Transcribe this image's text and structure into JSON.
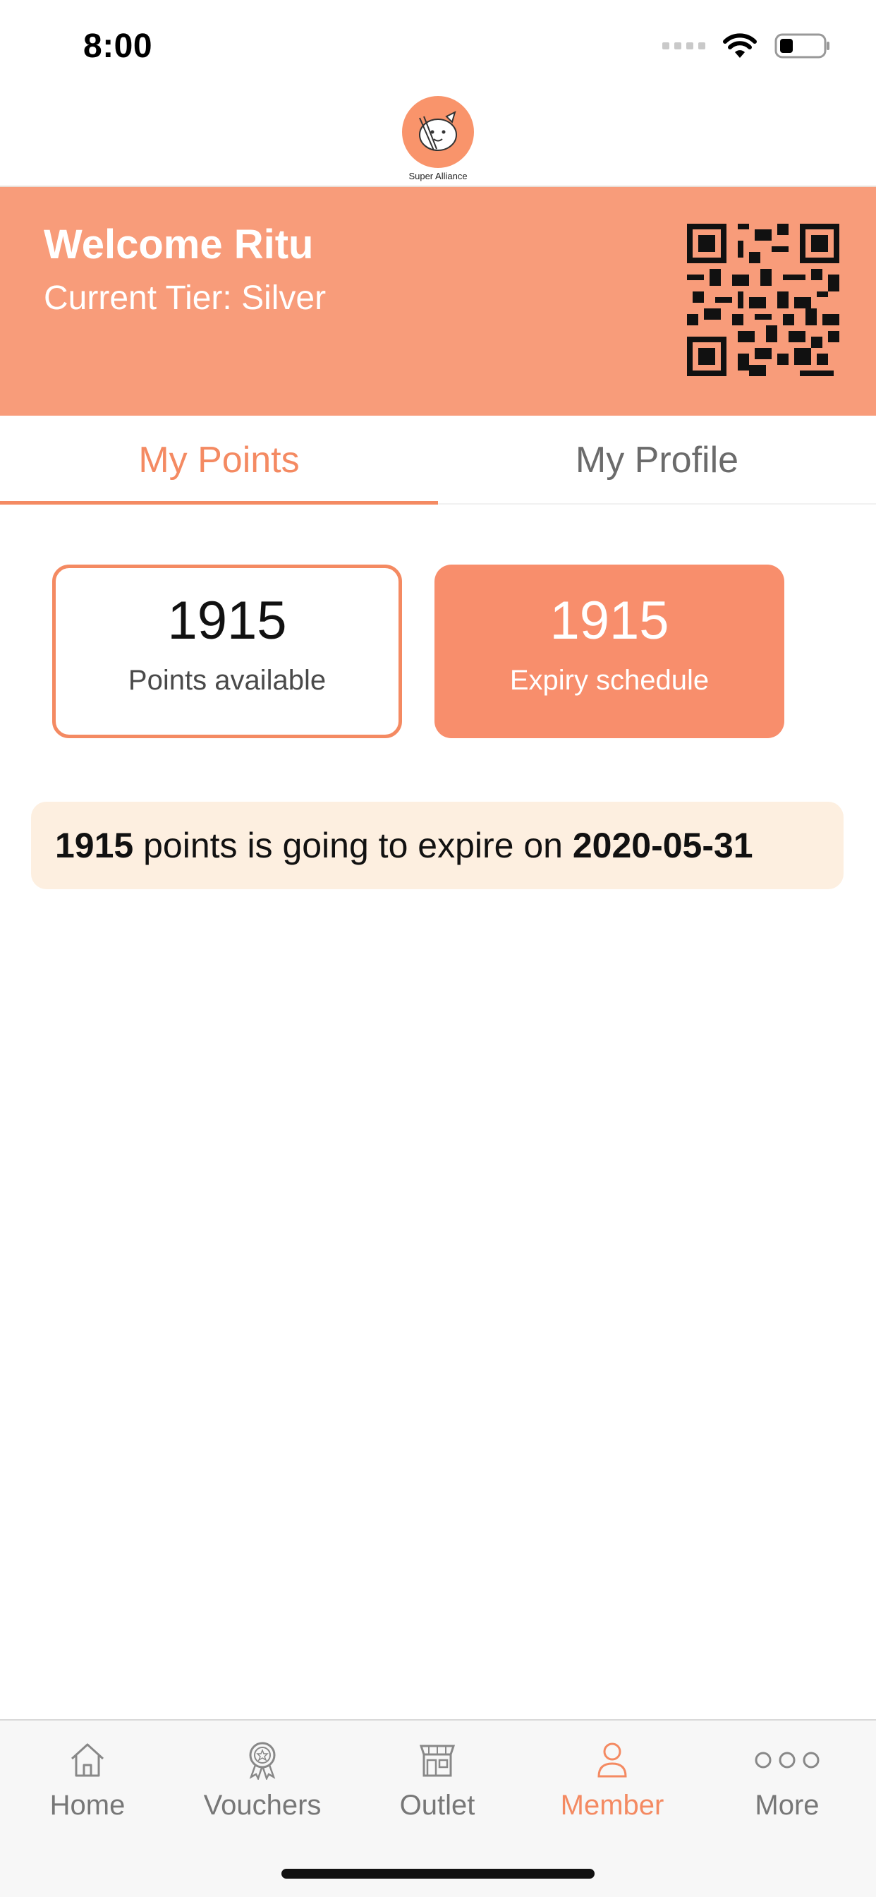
{
  "status_bar": {
    "time": "8:00",
    "icons": [
      "signal-icon",
      "wifi-icon",
      "battery-icon"
    ]
  },
  "header": {
    "logo_text": "Super Alliance",
    "logo_icon": "mascot-logo-icon"
  },
  "banner": {
    "welcome": "Welcome Ritu",
    "tier": "Current Tier: Silver",
    "qr_icon": "qr-code-icon"
  },
  "tabs": [
    {
      "label": "My Points",
      "active": true
    },
    {
      "label": "My Profile",
      "active": false
    }
  ],
  "cards": {
    "available": {
      "value": "1915",
      "label": "Points available"
    },
    "expiry": {
      "value": "1915",
      "label": "Expiry schedule"
    }
  },
  "expiry_notice": {
    "points": "1915",
    "text_middle": " points is going to expire on ",
    "date": "2020-05-31"
  },
  "tab_bar": [
    {
      "label": "Home",
      "icon": "home-icon",
      "active": false
    },
    {
      "label": "Vouchers",
      "icon": "voucher-badge-icon",
      "active": false
    },
    {
      "label": "Outlet",
      "icon": "store-icon",
      "active": false
    },
    {
      "label": "Member",
      "icon": "person-icon",
      "active": true
    },
    {
      "label": "More",
      "icon": "more-dots-icon",
      "active": false
    }
  ],
  "colors": {
    "accent": "#f48a62",
    "banner": "#f89c7a",
    "notice_bg": "#fdefe0",
    "inactive": "#777777"
  }
}
